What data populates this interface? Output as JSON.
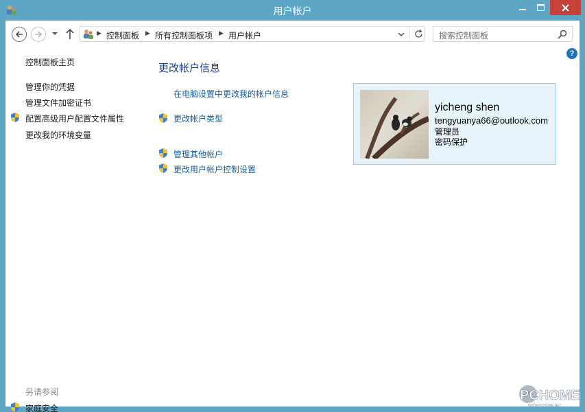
{
  "window": {
    "title": "用户帐户"
  },
  "nav": {
    "breadcrumbs": [
      "控制面板",
      "所有控制面板项",
      "用户帐户"
    ],
    "search_placeholder": "搜索控制面板"
  },
  "sidebar": {
    "items": [
      {
        "label": "控制面板主页",
        "shield": false
      },
      {
        "label": "管理你的凭据",
        "shield": false
      },
      {
        "label": "管理文件加密证书",
        "shield": false
      },
      {
        "label": "配置高级用户配置文件属性",
        "shield": true
      },
      {
        "label": "更改我的环境变量",
        "shield": false
      }
    ],
    "see_also_heading": "另请参阅",
    "see_also_items": [
      {
        "label": "家庭安全",
        "shield": true
      }
    ]
  },
  "main": {
    "title": "更改帐户信息",
    "links": [
      {
        "label": "在电脑设置中更改我的帐户信息",
        "shield": false
      },
      {
        "label": "更改帐户类型",
        "shield": true
      },
      {
        "label": "管理其他帐户",
        "shield": true
      },
      {
        "label": "更改用户帐户控制设置",
        "shield": true
      }
    ]
  },
  "user": {
    "name": "yicheng shen",
    "email": "tengyuanya66@outlook.com",
    "role": "管理员",
    "protection": "密码保护"
  },
  "watermark": {
    "brand": "PCHOME",
    "url": "WWW.PCHOME.NET"
  },
  "colors": {
    "frame": "#5ea6c6",
    "link": "#0f5fa8",
    "title": "#1a3e8a",
    "close": "#c7403a",
    "card_bg": "#e8f4fb"
  }
}
